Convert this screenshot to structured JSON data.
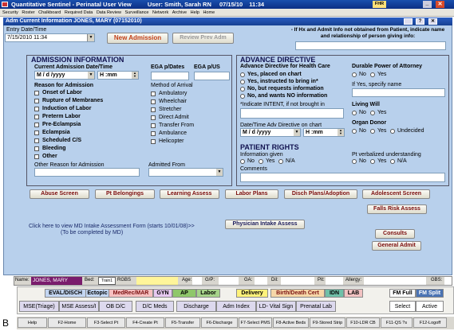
{
  "app": {
    "title": "Quantitative Sentinel - Perinatal User View",
    "user_label": "User:",
    "user": "Smith, Sarah RN",
    "date": "07/15/10",
    "time": "11:34",
    "fhr": "FHR"
  },
  "menu": [
    "Security",
    "Roster",
    "Chalkboard",
    "Required Data",
    "Data Review",
    "Surveillance",
    "Network",
    "Archive",
    "Help",
    "Home"
  ],
  "header": {
    "title": "Adm Current Information JONES, MARY (07152010)"
  },
  "entry": {
    "label": "Entry Date/Time",
    "value": "7/15/2010 11:34"
  },
  "buttons": {
    "new_admission": "New Admission",
    "review_prev": "Review Prev Adm",
    "abuse": "Abuse Screen",
    "belongings": "Pt Belongings",
    "learning": "Learning Assess",
    "labor_plans": "Labor Plans",
    "disch": "Disch Plans/Adoption",
    "adolescent": "Adolescent Screen",
    "falls": "Falls Risk Assess",
    "physician": "Physician Intake Assess",
    "consults": "Consults",
    "general_admit": "General Admit"
  },
  "hx_note": "- If Hx and Admit Info not obtained from Patient, indicate name and relationship of person giving info:",
  "admission": {
    "title": "ADMISSION INFORMATION",
    "current_label": "Current Admission Date/Time",
    "date_ph": "M / d /yyyy",
    "time_ph": "H :mm",
    "reason_label": "Reason for Admission",
    "reasons": [
      "Onset of Labor",
      "Rupture of Membranes",
      "Induction of Labor",
      "Preterm Labor",
      "Pre-Eclampsia",
      "Eclampsia",
      "Scheduled C/S",
      "Bleeding",
      "Other"
    ],
    "egad_label": "EGA p/Dates",
    "egau_label": "EGA p/US",
    "arrival_label": "Method of Arrival",
    "arrivals": [
      "Ambulatory",
      "Wheelchair",
      "Stretcher",
      "Direct Admit",
      "Transfer From",
      "Ambulance",
      "Helicopter"
    ],
    "other_reason_label": "Other Reason for Admission",
    "admitted_from_label": "Admitted From"
  },
  "advance": {
    "title": "ADVANCE DIRECTIVE",
    "hc_label": "Advance Directive for Health Care",
    "options": [
      "Yes, placed on chart",
      "Yes, instructed to bring in*",
      "No, but requests information",
      "No, and wants NO information"
    ],
    "intent_label": "*Indicate INTENT, if not brought in",
    "date_label": "Date/Time Adv Directive on chart",
    "date_ph": "M / d /yyyy",
    "time_ph": "H :mm",
    "dpa_label": "Durable Power of Attorney",
    "no": "No",
    "yes": "Yes",
    "specify_label": "If Yes, specify name",
    "living_will": "Living Will",
    "organ_donor": "Organ Donor",
    "undecided": "Undecided"
  },
  "rights": {
    "title": "PATIENT RIGHTS",
    "info_given": "Information given",
    "verbalized": "Pt verbalized understanding",
    "na": "N/A",
    "comments": "Comments"
  },
  "click_text": "Click here to view MD Intake Assessment Form (starts 10/01/08)>>",
  "click_sub": "(To be completed by MD)",
  "status": {
    "name_label": "Name:",
    "name": "JONES, MARY",
    "bed_label": "Bed:",
    "bed": "Train1",
    "rgbs": "RGBS",
    "age": "Age:",
    "gp": "G/P:",
    "ga": "GA:",
    "dil": "Dil:",
    "pit": "Pit:",
    "allergy": "Allergy:",
    "gbs": "GBS:"
  },
  "tabs1": [
    "EVAL/DISCH",
    "Ectopic",
    "MedRec/MAR",
    "GYN",
    "AP",
    "Labor",
    "Delivery",
    "Birth/Death Cert",
    "IDN",
    "LAB"
  ],
  "tabs2": [
    "MSE(Triage)",
    "MSE Assess/I",
    "OB D/C",
    "D/C Meds",
    "Discharge",
    "Adm Index",
    "LD- Vital Sign",
    "Prenatal Lab"
  ],
  "fm": {
    "full": "FM Full",
    "split": "FM Split",
    "select": "Select",
    "active": "Active"
  },
  "fkeys": [
    "Help",
    "F2-Home",
    "F3-Select Pt",
    "F4-Create Pt",
    "F5-Transfer",
    "F6-Discharge",
    "F7-Select PMS",
    "F8-Active Beds",
    "F9-Stored Strip",
    "F10-LDR CB",
    "F11-QS ?s",
    "F12-Logoff"
  ],
  "figure_label": "B"
}
